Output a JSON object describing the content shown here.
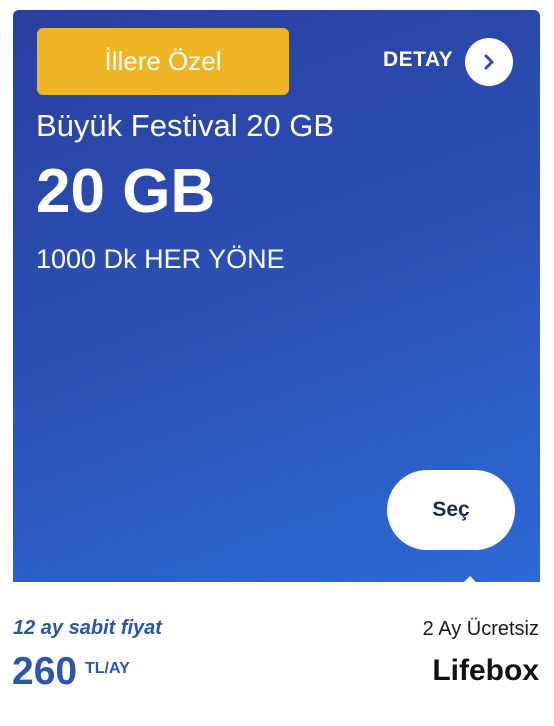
{
  "card": {
    "badge_label": "İllere Özel",
    "detail_label": "DETAY",
    "detail_icon": "chevron-right-icon",
    "title": "Büyük Festival 20 GB",
    "data_amount": "20 GB",
    "minutes": "1000 Dk HER YÖNE",
    "select_label": "Seç"
  },
  "footer": {
    "fixed_price_label": "12 ay sabit fiyat",
    "price_value": "260",
    "price_unit": "TL/AY",
    "promo_label": "2 Ay Ücretsiz",
    "brand_label": "Lifebox"
  },
  "colors": {
    "badge": "#f0b526",
    "card_gradient_start": "#2a3fa0",
    "card_gradient_end": "#2d6ad6",
    "price_text": "#2b55a8"
  }
}
